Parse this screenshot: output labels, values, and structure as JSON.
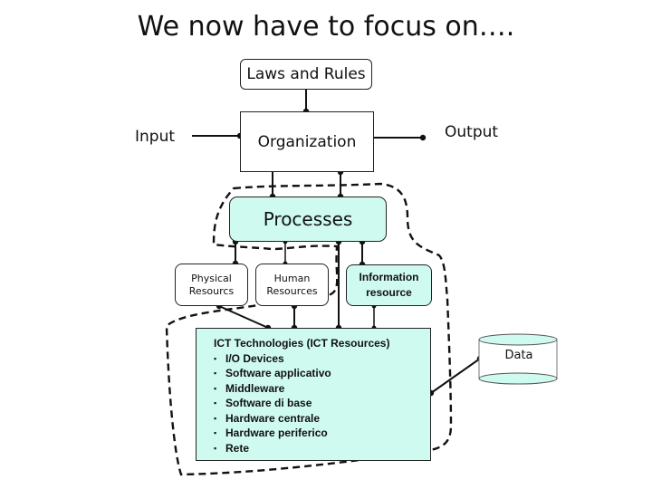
{
  "slide": {
    "title": "We now have to focus on…."
  },
  "diagram": {
    "laws_and_rules": "Laws and Rules",
    "input": "Input",
    "output": "Output",
    "organization": "Organization",
    "processes": "Processes",
    "physical_resources": {
      "line1": "Physical",
      "line2": "Resourcs"
    },
    "human_resources": {
      "line1": "Human",
      "line2": "Resources"
    },
    "information_resource": {
      "line1": "Information",
      "line2": "resource"
    },
    "ict": {
      "heading": "ICT Technologies (ICT Resources)",
      "items": [
        "I/O Devices",
        "Software applicativo",
        "Middleware",
        "Software di base",
        "Hardware centrale",
        "Hardware periferico",
        "Rete"
      ]
    },
    "data_store": "Data"
  },
  "colors": {
    "accent_fill": "#cffaf0",
    "stroke": "#111111"
  }
}
